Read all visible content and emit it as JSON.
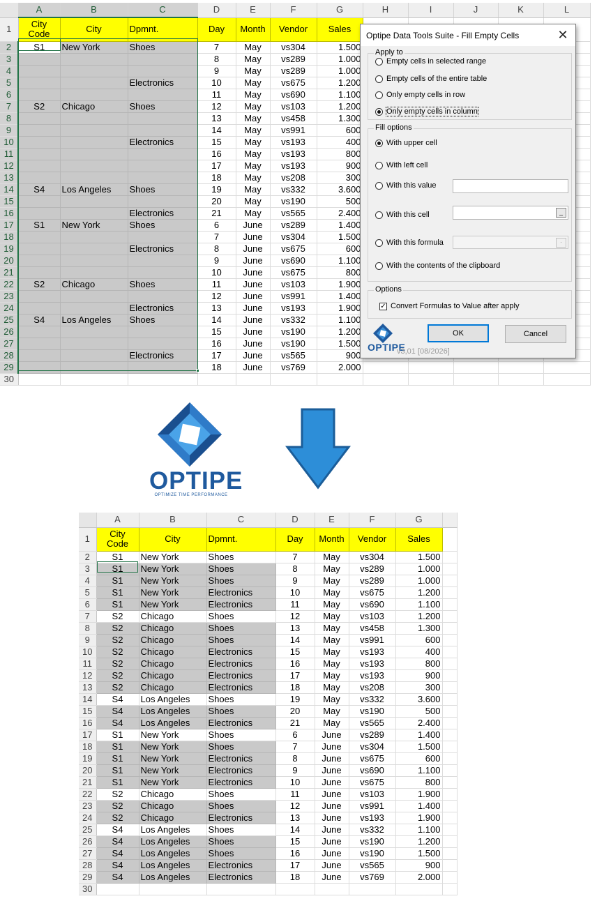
{
  "columns_top": [
    "A",
    "B",
    "C",
    "D",
    "E",
    "F",
    "G",
    "H",
    "I",
    "J",
    "K",
    "L"
  ],
  "columns_bottom": [
    "A",
    "B",
    "C",
    "D",
    "E",
    "F",
    "G"
  ],
  "headers": {
    "city_code": "City Code",
    "city": "City",
    "dpmnt": "Dpmnt.",
    "day": "Day",
    "month": "Month",
    "vendor": "Vendor",
    "sales": "Sales"
  },
  "top_rows": [
    {
      "n": "2",
      "a": "S1",
      "b": "New York",
      "c": "Shoes",
      "d": "7",
      "e": "May",
      "f": "vs304",
      "g": "1.500"
    },
    {
      "n": "3",
      "a": "",
      "b": "",
      "c": "",
      "d": "8",
      "e": "May",
      "f": "vs289",
      "g": "1.000"
    },
    {
      "n": "4",
      "a": "",
      "b": "",
      "c": "",
      "d": "9",
      "e": "May",
      "f": "vs289",
      "g": "1.000"
    },
    {
      "n": "5",
      "a": "",
      "b": "",
      "c": "Electronics",
      "d": "10",
      "e": "May",
      "f": "vs675",
      "g": "1.200"
    },
    {
      "n": "6",
      "a": "",
      "b": "",
      "c": "",
      "d": "11",
      "e": "May",
      "f": "vs690",
      "g": "1.100"
    },
    {
      "n": "7",
      "a": "S2",
      "b": "Chicago",
      "c": "Shoes",
      "d": "12",
      "e": "May",
      "f": "vs103",
      "g": "1.200"
    },
    {
      "n": "8",
      "a": "",
      "b": "",
      "c": "",
      "d": "13",
      "e": "May",
      "f": "vs458",
      "g": "1.300"
    },
    {
      "n": "9",
      "a": "",
      "b": "",
      "c": "",
      "d": "14",
      "e": "May",
      "f": "vs991",
      "g": "600"
    },
    {
      "n": "10",
      "a": "",
      "b": "",
      "c": "Electronics",
      "d": "15",
      "e": "May",
      "f": "vs193",
      "g": "400"
    },
    {
      "n": "11",
      "a": "",
      "b": "",
      "c": "",
      "d": "16",
      "e": "May",
      "f": "vs193",
      "g": "800"
    },
    {
      "n": "12",
      "a": "",
      "b": "",
      "c": "",
      "d": "17",
      "e": "May",
      "f": "vs193",
      "g": "900"
    },
    {
      "n": "13",
      "a": "",
      "b": "",
      "c": "",
      "d": "18",
      "e": "May",
      "f": "vs208",
      "g": "300"
    },
    {
      "n": "14",
      "a": "S4",
      "b": "Los Angeles",
      "c": "Shoes",
      "d": "19",
      "e": "May",
      "f": "vs332",
      "g": "3.600"
    },
    {
      "n": "15",
      "a": "",
      "b": "",
      "c": "",
      "d": "20",
      "e": "May",
      "f": "vs190",
      "g": "500"
    },
    {
      "n": "16",
      "a": "",
      "b": "",
      "c": "Electronics",
      "d": "21",
      "e": "May",
      "f": "vs565",
      "g": "2.400"
    },
    {
      "n": "17",
      "a": "S1",
      "b": "New York",
      "c": "Shoes",
      "d": "6",
      "e": "June",
      "f": "vs289",
      "g": "1.400"
    },
    {
      "n": "18",
      "a": "",
      "b": "",
      "c": "",
      "d": "7",
      "e": "June",
      "f": "vs304",
      "g": "1.500"
    },
    {
      "n": "19",
      "a": "",
      "b": "",
      "c": "Electronics",
      "d": "8",
      "e": "June",
      "f": "vs675",
      "g": "600"
    },
    {
      "n": "20",
      "a": "",
      "b": "",
      "c": "",
      "d": "9",
      "e": "June",
      "f": "vs690",
      "g": "1.100"
    },
    {
      "n": "21",
      "a": "",
      "b": "",
      "c": "",
      "d": "10",
      "e": "June",
      "f": "vs675",
      "g": "800"
    },
    {
      "n": "22",
      "a": "S2",
      "b": "Chicago",
      "c": "Shoes",
      "d": "11",
      "e": "June",
      "f": "vs103",
      "g": "1.900"
    },
    {
      "n": "23",
      "a": "",
      "b": "",
      "c": "",
      "d": "12",
      "e": "June",
      "f": "vs991",
      "g": "1.400"
    },
    {
      "n": "24",
      "a": "",
      "b": "",
      "c": "Electronics",
      "d": "13",
      "e": "June",
      "f": "vs193",
      "g": "1.900"
    },
    {
      "n": "25",
      "a": "S4",
      "b": "Los Angeles",
      "c": "Shoes",
      "d": "14",
      "e": "June",
      "f": "vs332",
      "g": "1.100"
    },
    {
      "n": "26",
      "a": "",
      "b": "",
      "c": "",
      "d": "15",
      "e": "June",
      "f": "vs190",
      "g": "1.200"
    },
    {
      "n": "27",
      "a": "",
      "b": "",
      "c": "",
      "d": "16",
      "e": "June",
      "f": "vs190",
      "g": "1.500"
    },
    {
      "n": "28",
      "a": "",
      "b": "",
      "c": "Electronics",
      "d": "17",
      "e": "June",
      "f": "vs565",
      "g": "900"
    },
    {
      "n": "29",
      "a": "",
      "b": "",
      "c": "",
      "d": "18",
      "e": "June",
      "f": "vs769",
      "g": "2.000"
    }
  ],
  "bottom_rows": [
    {
      "n": "2",
      "a": "S1",
      "b": "New York",
      "c": "Shoes",
      "d": "7",
      "e": "May",
      "f": "vs304",
      "g": "1.500",
      "filled": false
    },
    {
      "n": "3",
      "a": "S1",
      "b": "New York",
      "c": "Shoes",
      "d": "8",
      "e": "May",
      "f": "vs289",
      "g": "1.000",
      "filled": true
    },
    {
      "n": "4",
      "a": "S1",
      "b": "New York",
      "c": "Shoes",
      "d": "9",
      "e": "May",
      "f": "vs289",
      "g": "1.000",
      "filled": true
    },
    {
      "n": "5",
      "a": "S1",
      "b": "New York",
      "c": "Electronics",
      "d": "10",
      "e": "May",
      "f": "vs675",
      "g": "1.200",
      "filled": true
    },
    {
      "n": "6",
      "a": "S1",
      "b": "New York",
      "c": "Electronics",
      "d": "11",
      "e": "May",
      "f": "vs690",
      "g": "1.100",
      "filled": true
    },
    {
      "n": "7",
      "a": "S2",
      "b": "Chicago",
      "c": "Shoes",
      "d": "12",
      "e": "May",
      "f": "vs103",
      "g": "1.200",
      "filled": false
    },
    {
      "n": "8",
      "a": "S2",
      "b": "Chicago",
      "c": "Shoes",
      "d": "13",
      "e": "May",
      "f": "vs458",
      "g": "1.300",
      "filled": true
    },
    {
      "n": "9",
      "a": "S2",
      "b": "Chicago",
      "c": "Shoes",
      "d": "14",
      "e": "May",
      "f": "vs991",
      "g": "600",
      "filled": true
    },
    {
      "n": "10",
      "a": "S2",
      "b": "Chicago",
      "c": "Electronics",
      "d": "15",
      "e": "May",
      "f": "vs193",
      "g": "400",
      "filled": true
    },
    {
      "n": "11",
      "a": "S2",
      "b": "Chicago",
      "c": "Electronics",
      "d": "16",
      "e": "May",
      "f": "vs193",
      "g": "800",
      "filled": true
    },
    {
      "n": "12",
      "a": "S2",
      "b": "Chicago",
      "c": "Electronics",
      "d": "17",
      "e": "May",
      "f": "vs193",
      "g": "900",
      "filled": true
    },
    {
      "n": "13",
      "a": "S2",
      "b": "Chicago",
      "c": "Electronics",
      "d": "18",
      "e": "May",
      "f": "vs208",
      "g": "300",
      "filled": true
    },
    {
      "n": "14",
      "a": "S4",
      "b": "Los Angeles",
      "c": "Shoes",
      "d": "19",
      "e": "May",
      "f": "vs332",
      "g": "3.600",
      "filled": false
    },
    {
      "n": "15",
      "a": "S4",
      "b": "Los Angeles",
      "c": "Shoes",
      "d": "20",
      "e": "May",
      "f": "vs190",
      "g": "500",
      "filled": true
    },
    {
      "n": "16",
      "a": "S4",
      "b": "Los Angeles",
      "c": "Electronics",
      "d": "21",
      "e": "May",
      "f": "vs565",
      "g": "2.400",
      "filled": true
    },
    {
      "n": "17",
      "a": "S1",
      "b": "New York",
      "c": "Shoes",
      "d": "6",
      "e": "June",
      "f": "vs289",
      "g": "1.400",
      "filled": false
    },
    {
      "n": "18",
      "a": "S1",
      "b": "New York",
      "c": "Shoes",
      "d": "7",
      "e": "June",
      "f": "vs304",
      "g": "1.500",
      "filled": true
    },
    {
      "n": "19",
      "a": "S1",
      "b": "New York",
      "c": "Electronics",
      "d": "8",
      "e": "June",
      "f": "vs675",
      "g": "600",
      "filled": true
    },
    {
      "n": "20",
      "a": "S1",
      "b": "New York",
      "c": "Electronics",
      "d": "9",
      "e": "June",
      "f": "vs690",
      "g": "1.100",
      "filled": true
    },
    {
      "n": "21",
      "a": "S1",
      "b": "New York",
      "c": "Electronics",
      "d": "10",
      "e": "June",
      "f": "vs675",
      "g": "800",
      "filled": true
    },
    {
      "n": "22",
      "a": "S2",
      "b": "Chicago",
      "c": "Shoes",
      "d": "11",
      "e": "June",
      "f": "vs103",
      "g": "1.900",
      "filled": false
    },
    {
      "n": "23",
      "a": "S2",
      "b": "Chicago",
      "c": "Shoes",
      "d": "12",
      "e": "June",
      "f": "vs991",
      "g": "1.400",
      "filled": true
    },
    {
      "n": "24",
      "a": "S2",
      "b": "Chicago",
      "c": "Electronics",
      "d": "13",
      "e": "June",
      "f": "vs193",
      "g": "1.900",
      "filled": true
    },
    {
      "n": "25",
      "a": "S4",
      "b": "Los Angeles",
      "c": "Shoes",
      "d": "14",
      "e": "June",
      "f": "vs332",
      "g": "1.100",
      "filled": false
    },
    {
      "n": "26",
      "a": "S4",
      "b": "Los Angeles",
      "c": "Shoes",
      "d": "15",
      "e": "June",
      "f": "vs190",
      "g": "1.200",
      "filled": true
    },
    {
      "n": "27",
      "a": "S4",
      "b": "Los Angeles",
      "c": "Shoes",
      "d": "16",
      "e": "June",
      "f": "vs190",
      "g": "1.500",
      "filled": true
    },
    {
      "n": "28",
      "a": "S4",
      "b": "Los Angeles",
      "c": "Electronics",
      "d": "17",
      "e": "June",
      "f": "vs565",
      "g": "900",
      "filled": true
    },
    {
      "n": "29",
      "a": "S4",
      "b": "Los Angeles",
      "c": "Electronics",
      "d": "18",
      "e": "June",
      "f": "vs769",
      "g": "2.000",
      "filled": true
    }
  ],
  "last_row_label": "30",
  "first_row_label": "1",
  "dialog": {
    "title": "Optipe Data Tools Suite - Fill Empty Cells",
    "close_glyph": "✕",
    "apply_to_label": "Apply to",
    "apply_options": [
      "Empty cells in selected range",
      "Empty cells of the entire table",
      "Only empty cells in row",
      "Only empty cells in column"
    ],
    "apply_selected_index": 3,
    "fill_options_label": "Fill options",
    "fill_upper": "With upper cell",
    "fill_left": "With left cell",
    "fill_value": "With this value",
    "fill_cell": "With this cell",
    "fill_formula": "With this formula",
    "fill_clipboard": "With the contents of the clipboard",
    "fill_selected": "upper",
    "cell_picker_glyph": "_",
    "formula_picker_glyph": "·",
    "options_label": "Options",
    "convert_label": "Convert Formulas to Value after apply",
    "convert_checked": true,
    "check_glyph": "✓",
    "ok_label": "OK",
    "cancel_label": "Cancel",
    "brand": "OPTIPE",
    "version": "v3,01 [08/2026]"
  },
  "logo": {
    "brand": "OPTIPE",
    "tagline": "OPTIMIZE TIME PERFORMANCE"
  },
  "colors": {
    "header_yellow": "#ffff00",
    "selection_green": "#217346",
    "filled_gray": "#c9c9c9",
    "brand_blue": "#1f5a9e"
  }
}
